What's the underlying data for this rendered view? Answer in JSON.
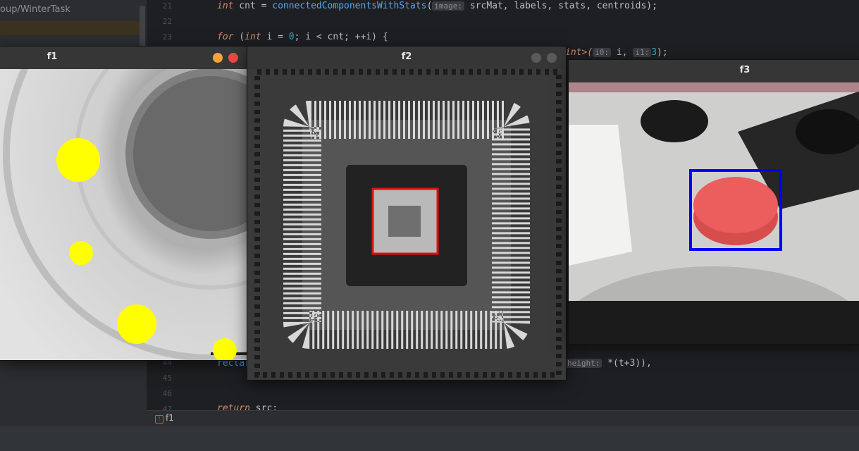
{
  "project": {
    "path": "oup/WinterTask"
  },
  "editor": {
    "lines": [
      {
        "num": "21"
      },
      {
        "num": "22"
      },
      {
        "num": "23"
      },
      {
        "num": "44"
      },
      {
        "num": "45"
      },
      {
        "num": "46"
      },
      {
        "num": "47"
      }
    ],
    "line21": {
      "kw": "int",
      "var": " cnt = ",
      "fn": "connectedComponentsWithStats",
      "open": "(",
      "hint": "image:",
      "rest": " srcMat, labels, stats, centroids);"
    },
    "line23": {
      "kw": "for",
      "a": " (",
      "kw2": "int",
      "b": " i = ",
      "zero": "0",
      "c": "; i < cnt; ++i) {"
    },
    "line24": {
      "tpl": "int>(",
      "hint1": "i0:",
      "a": " i, ",
      "hint2": "i1:",
      "num": "3",
      "b": ");"
    },
    "line44": {
      "start": "rectar",
      "hint": "height:",
      "rest": " *(t+3)),"
    },
    "line47": {
      "kw": "return",
      "rest": " src;"
    }
  },
  "status": {
    "icon": "error-icon",
    "tab": "f1"
  },
  "windows": {
    "f1": {
      "title": "f1"
    },
    "f2": {
      "title": "f2"
    },
    "f3": {
      "title": "f3"
    }
  },
  "colors": {
    "accent": "#3574f0",
    "minimize": "#f2a33a",
    "close": "#e94a45",
    "circle": "#ffff00",
    "roi_red": "#e01010",
    "roi_blue": "#0000ff"
  }
}
